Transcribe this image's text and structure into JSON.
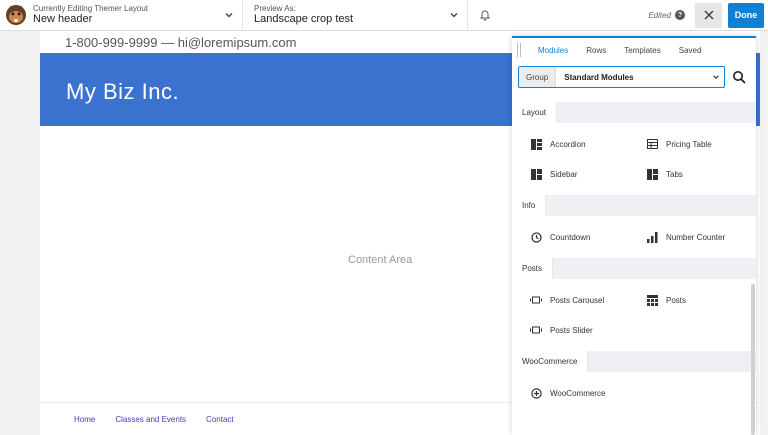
{
  "topbar": {
    "theme_label": "Currently Editing Themer Layout",
    "theme_value": "New header",
    "preview_label": "Preview As:",
    "preview_value": "Landscape crop test",
    "edited_label": "Edited",
    "done_label": "Done"
  },
  "page": {
    "contact": "1-800-999-9999 — hi@loremipsum.com",
    "site_title": "My Biz Inc.",
    "content_label": "Content Area",
    "footer_links": [
      "Home",
      "Classes and Events",
      "Contact"
    ]
  },
  "panel": {
    "tabs": [
      "Modules",
      "Rows",
      "Templates",
      "Saved"
    ],
    "group_label": "Group",
    "group_value": "Standard Modules",
    "sections": [
      {
        "title": "Layout",
        "modules": [
          {
            "label": "Accordion",
            "icon": "accordion-icon"
          },
          {
            "label": "Pricing Table",
            "icon": "pricing-table-icon"
          },
          {
            "label": "Sidebar",
            "icon": "sidebar-icon"
          },
          {
            "label": "Tabs",
            "icon": "tabs-icon"
          }
        ]
      },
      {
        "title": "Info",
        "modules": [
          {
            "label": "Countdown",
            "icon": "clock-icon"
          },
          {
            "label": "Number Counter",
            "icon": "bar-chart-icon"
          }
        ]
      },
      {
        "title": "Posts",
        "modules": [
          {
            "label": "Posts Carousel",
            "icon": "carousel-icon"
          },
          {
            "label": "Posts",
            "icon": "posts-grid-icon"
          },
          {
            "label": "Posts Slider",
            "icon": "slider-icon"
          }
        ]
      },
      {
        "title": "WooCommerce",
        "modules": [
          {
            "label": "WooCommerce",
            "icon": "plus-circle-icon"
          }
        ]
      }
    ]
  },
  "colors": {
    "accent": "#0e80d5",
    "banner": "#3b71cf",
    "footer_link": "#3b3fb6"
  }
}
